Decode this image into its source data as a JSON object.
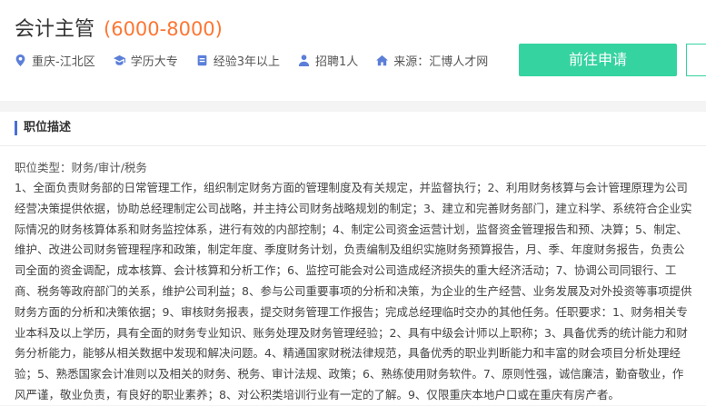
{
  "job": {
    "title": "会计主管",
    "salary": "(6000-8000)"
  },
  "meta": {
    "location": "重庆-江北区",
    "education": "学历大专",
    "experience": "经验3年以上",
    "headcount": "招聘1人",
    "source": "来源：汇博人才网"
  },
  "actions": {
    "apply_label": "前往申请"
  },
  "description": {
    "section_title": "职位描述",
    "category": "职位类型：财务/审计/税务",
    "text": "1、全面负责财务部的日常管理工作，组织制定财务方面的管理制度及有关规定，并监督执行；2、利用财务核算与会计管理原理为公司经营决策提供依据，协助总经理制定公司战略，并主持公司财务战略规划的制定；3、建立和完善财务部门，建立科学、系统符合企业实际情况的财务核算体系和财务监控体系，进行有效的内部控制；4、制定公司资金运营计划，监督资金管理报告和预、决算；5、制定、维护、改进公司财务管理程序和政策，制定年度、季度财务计划，负责编制及组织实施财务预算报告，月、季、年度财务报告，负责公司全面的资金调配，成本核算、会计核算和分析工作；6、监控可能会对公司造成经济损失的重大经济活动；7、协调公司同银行、工商、税务等政府部门的关系，维护公司利益；8、参与公司重要事项的分析和决策，为企业的生产经营、业务发展及对外投资等事项提供财务方面的分析和决策依据；9、审核财务报表，提交财务管理工作报告；完成总经理临时交办的其他任务。任职要求：1、财务相关专业本科及以上学历，具有全面的财务专业知识、账务处理及财务管理经验；2、具有中级会计师以上职称；3、具备优秀的统计能力和财务分析能力，能够从相关数据中发现和解决问题。4、精通国家财税法律规范，具备优秀的职业判断能力和丰富的财会项目分析处理经验；5、熟悉国家会计准则以及相关的财务、税务、审计法规、政策；6、熟练使用财务软件。7、原则性强，诚信廉洁，勤奋敬业，作风严谨，敬业负责，有良好的职业素养；8、对公积类培训行业有一定的了解。9、仅限重庆本地户口或在重庆有房产者。"
  },
  "colors": {
    "accent": "#35d3a0",
    "salary": "#fd7633",
    "icon": "#5b7fd9",
    "section_marker": "#4a6fd6"
  }
}
